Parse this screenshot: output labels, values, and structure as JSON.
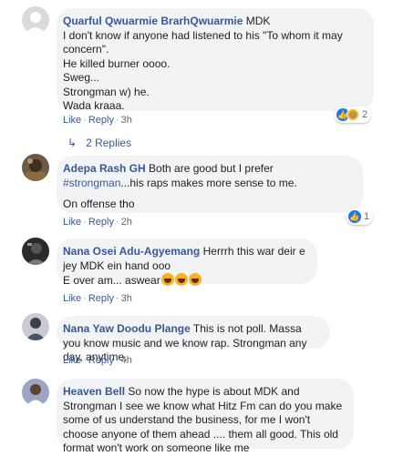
{
  "comments": [
    {
      "author": "Quarful Qwuarmie BrarhQwuarmie",
      "text": " MDK\nI don't know if anyone had listened to his \"To whom it may concern\".\nHe killed burner oooo.\nSweg...\nStrongman w) he.\nWada kraaa.",
      "like": "Like",
      "reply": "Reply",
      "time": "3h",
      "reactions": "2",
      "reaction_icons": [
        "like-icon",
        "haha-icon"
      ]
    },
    {
      "author": "Adepa Rash GH",
      "text": " Both are good but I prefer ",
      "hashtag": "#strongman",
      "text_rest": "...his raps makes more sense to me.",
      "text2": "On offense tho",
      "like": "Like",
      "reply": "Reply",
      "time": "2h",
      "reactions": "1",
      "reaction_icons": [
        "like-icon"
      ]
    },
    {
      "author": "Nana Osei Adu-Agyemang",
      "text": " Herrrh this war deir e jey MDK ein hand ooo\nE over am... aswear",
      "emojis": [
        "laughing-emoji",
        "laughing-emoji",
        "laughing-emoji"
      ],
      "like": "Like",
      "reply": "Reply",
      "time": "3h"
    },
    {
      "author": "Nana Yaw Doodu Plange",
      "text": " This is not poll. Massa you know music and we know rap. Strongman any day, anytime.",
      "like": "Like",
      "reply": "Reply",
      "time": "4h"
    },
    {
      "author": "Heaven Bell",
      "text": " So now the hype is about MDK and Strongman I see we know what Hitz Fm can do you make some of us understand the business, for me I won't choose anyone of them ahead .... them all good. This old format won't work on someone like me"
    }
  ],
  "replies_label": "2 Replies",
  "colors": {
    "link": "#385898",
    "bubble": "#f2f3f5",
    "meta": "#606770",
    "like": "#1877f2",
    "haha": "#f7b125"
  }
}
